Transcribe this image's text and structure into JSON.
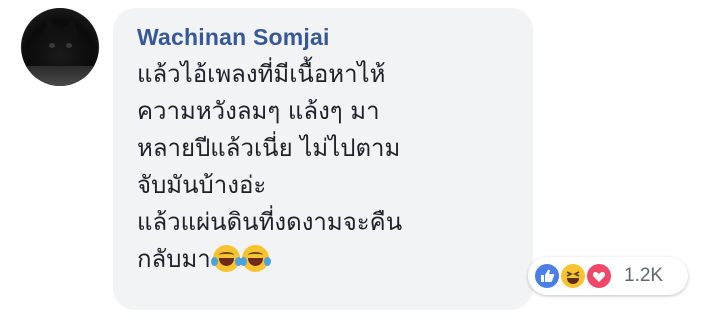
{
  "comment": {
    "author": "Wachinan Somjai",
    "text_lines": [
      "แล้วไอ้เพลงที่มีเนื้อหาไห้",
      "ความหวังลมๆ แล้งๆ มา",
      "หลายปีแล้วเนี่ย ไม่ไปตาม",
      "จับมันบ้างอ่ะ",
      "แล้วแผ่นดินที่งดงามจะคืน",
      "กลับมา"
    ],
    "trailing_emoji": [
      "joy-emoji",
      "joy-emoji"
    ]
  },
  "reactions": {
    "types": [
      "like",
      "haha",
      "love"
    ],
    "count": "1.2K",
    "colors": {
      "like": "#4a7ee8",
      "haha": "#f7c32e",
      "love": "#ef4868"
    }
  },
  "colors": {
    "author": "#365899",
    "bubble": "#f2f3f5",
    "text": "#1d2129"
  }
}
